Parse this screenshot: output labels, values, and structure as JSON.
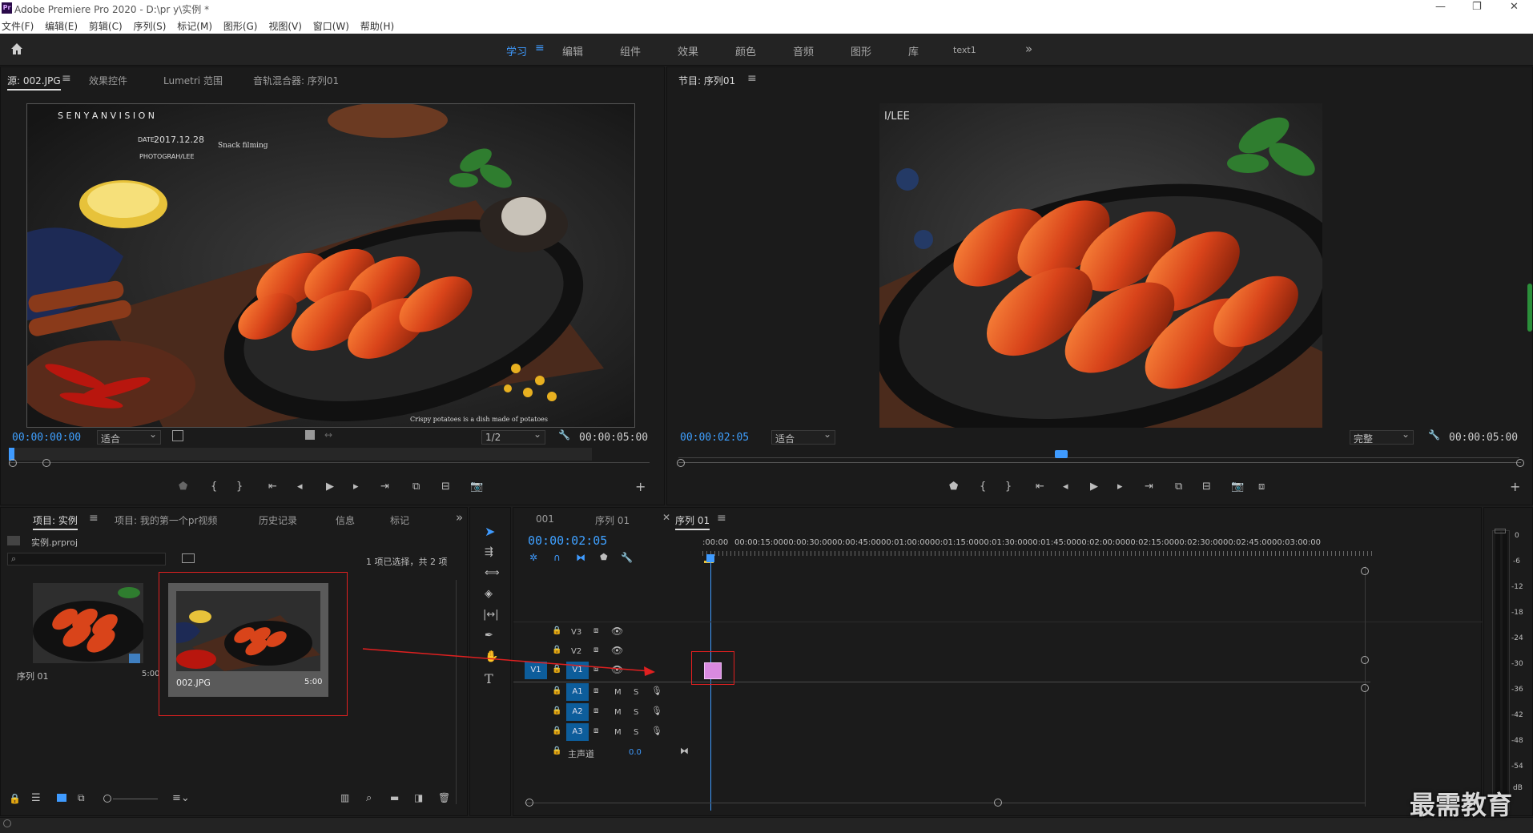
{
  "window": {
    "logo": "Pr",
    "title": "Adobe Premiere Pro 2020 - D:\\pr y\\实例 *",
    "controls": [
      "—",
      "❐",
      "✕"
    ]
  },
  "menu": [
    "文件(F)",
    "编辑(E)",
    "剪辑(C)",
    "序列(S)",
    "标记(M)",
    "图形(G)",
    "视图(V)",
    "窗口(W)",
    "帮助(H)"
  ],
  "workspaces": {
    "tabs": [
      "学习",
      "编辑",
      "组件",
      "效果",
      "颜色",
      "音频",
      "图形",
      "库",
      "text1"
    ],
    "active": "学习",
    "more": "»"
  },
  "source": {
    "tabs": [
      "源: 002.JPG",
      "效果控件",
      "Lumetri 范围",
      "音轨混合器: 序列01"
    ],
    "timecode": "00:00:00:00",
    "fit": "适合",
    "resolution": "1/2",
    "duration": "00:00:05:00",
    "image_text": {
      "brand": "S  E  N  Y  A  N     V  I  S  I  O  N",
      "date_label": "DATE:",
      "date": "2017.12.28",
      "snack": "Snack filming",
      "photograph": "PHOTOGRAH/LEE",
      "caption": "Crispy potatoes is a dish made of potatoes"
    }
  },
  "program": {
    "tab": "节目: 序列01",
    "timecode": "00:00:02:05",
    "fit": "适合",
    "quality": "完整",
    "duration": "00:00:05:00",
    "image_text": "I/LEE"
  },
  "project": {
    "tabs": [
      "项目: 实例",
      "项目: 我的第一个pr视频",
      "历史记录",
      "信息",
      "标记"
    ],
    "more": "»",
    "file": "实例.prproj",
    "selection_info": "1 项已选择，共 2 项",
    "items": [
      {
        "name": "序列 01",
        "duration": "5:00"
      },
      {
        "name": "002.JPG",
        "duration": "5:00"
      }
    ]
  },
  "timeline": {
    "tabs": [
      "001",
      "序列 01",
      "序列 01"
    ],
    "timecode": "00:00:02:05",
    "ruler": [
      ":00:00",
      "00:00:15:00",
      "00:00:30:00",
      "00:00:45:00",
      "00:01:00:00",
      "00:01:15:00",
      "00:01:30:00",
      "00:01:45:00",
      "00:02:00:00",
      "00:02:15:00",
      "00:02:30:00",
      "00:02:45:00",
      "00:03:00:00"
    ],
    "video_tracks": [
      "V3",
      "V2",
      "V1"
    ],
    "audio_tracks": [
      "A1",
      "A2",
      "A3"
    ],
    "mute": "M",
    "solo": "S",
    "master": "主声道",
    "master_value": "0.0",
    "source_patch": "V1"
  },
  "meter": {
    "scale": [
      "0",
      "-6",
      "-12",
      "-18",
      "-24",
      "-30",
      "-36",
      "-42",
      "-48",
      "-54"
    ],
    "unit": "dB"
  },
  "watermark": "最需教育",
  "colors": {
    "accent": "#3f9bff",
    "clip": "#d98ae0",
    "annotation": "#e02020"
  }
}
